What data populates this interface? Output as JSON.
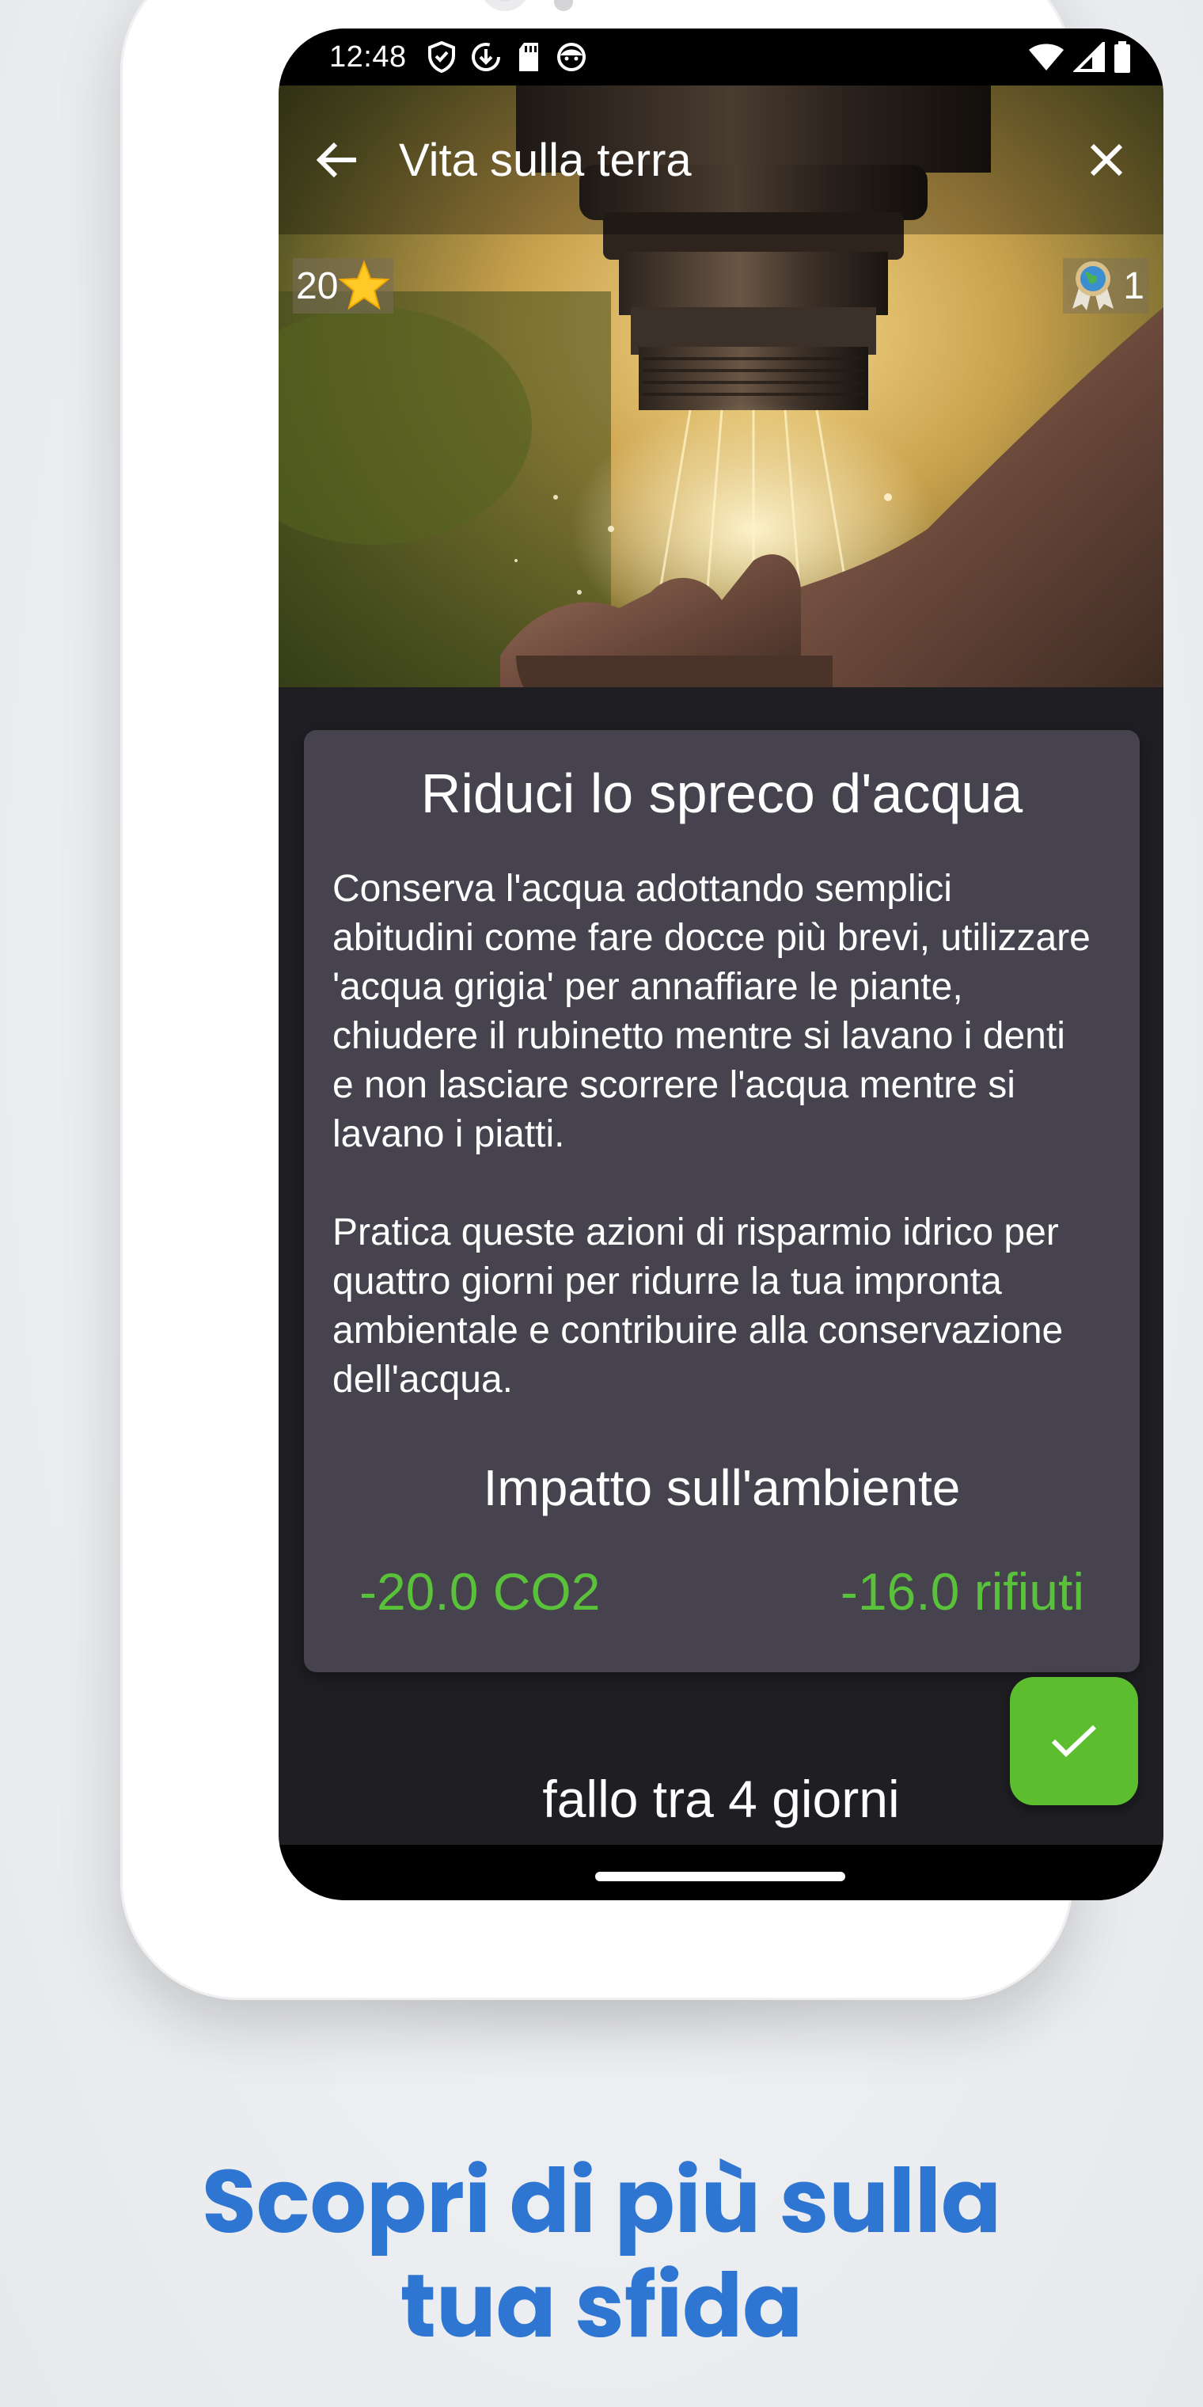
{
  "status_bar": {
    "time": "12:48"
  },
  "toolbar": {
    "title": "Vita sulla terra"
  },
  "badges": {
    "points": "20",
    "awards": "1"
  },
  "card": {
    "title": "Riduci lo spreco d'acqua",
    "paragraph1": "Conserva l'acqua adottando semplici abitudini come fare docce più brevi, utilizzare 'acqua grigia' per annaffiare le piante, chiudere il rubinetto mentre si lavano i denti e non lasciare scorrere l'acqua mentre si lavano i piatti.",
    "paragraph2": "Pratica queste azioni di risparmio idrico per quattro giorni per ridurre la tua impronta ambientale e contribuire alla conservazione dell'acqua.",
    "impact_title": "Impatto sull'ambiente",
    "co2": "-20.0 CO2",
    "waste": "-16.0 rifiuti"
  },
  "deadline": "fallo tra 4 giorni",
  "headline": {
    "line1": "Scopri di più sulla",
    "line2": "tua sfida"
  },
  "colors": {
    "accent_green": "#5cbe2e",
    "impact_green": "#59c23a",
    "card_bg": "#46434f",
    "headline_blue": "#2f76d2"
  },
  "icons": {
    "back": "arrow-left-icon",
    "close": "close-icon",
    "points": "star-icon",
    "award": "earth-medal-icon",
    "complete": "checkmark-icon"
  }
}
